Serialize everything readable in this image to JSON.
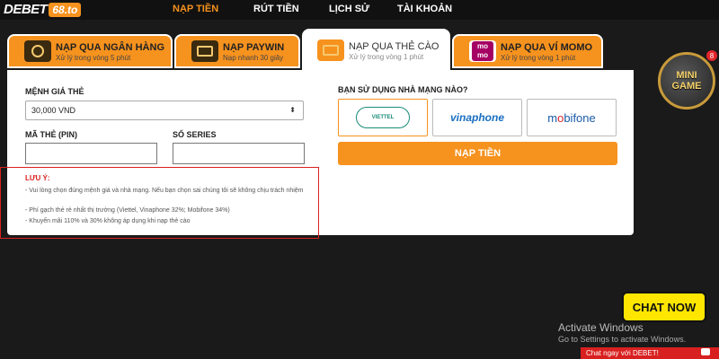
{
  "header": {
    "logo_text": "DEBET",
    "logo_domain": "68.to",
    "nav": [
      {
        "label": "NẠP TIỀN",
        "active": true
      },
      {
        "label": "RÚT TIỀN",
        "active": false
      },
      {
        "label": "LỊCH SỬ",
        "active": false
      },
      {
        "label": "TÀI KHOẢN",
        "active": false
      }
    ]
  },
  "tabs": [
    {
      "title": "NẠP QUA NGÂN HÀNG",
      "sub": "Xử lý trong vòng 5 phút",
      "icon": "bank-card-icon"
    },
    {
      "title": "NẠP PAYWIN",
      "sub": "Nạp nhanh 30 giây",
      "icon": "paywin-icon"
    },
    {
      "title": "NẠP QUA THẺ CÀO",
      "sub": "Xử lý trong vòng 1 phút",
      "icon": "scratch-card-icon",
      "active": true
    },
    {
      "title": "NẠP QUA VÍ MOMO",
      "sub": "Xử lý trong vòng 1 phút",
      "icon": "momo-icon"
    }
  ],
  "form": {
    "denomination_label": "MỆNH GIÁ THẺ",
    "denomination_value": "30,000 VND",
    "pin_label": "MÃ THẺ (PIN)",
    "series_label": "SỐ SERIES",
    "pin_value": "",
    "series_value": ""
  },
  "note": {
    "title": "LƯU Ý:",
    "lines": [
      "- Vui lòng chọn đúng mệnh giá và nhà mạng. Nếu bạn chọn sai chúng tôi sẽ không chịu trách nhiệm",
      "- Phí gạch thẻ rẻ nhất thị trường (Viettel, Vinaphone 32%; Mobifone 34%)",
      "- Khuyến mãi 110% và 30% không áp dụng khi nạp thẻ cào"
    ]
  },
  "carrier": {
    "label": "BẠN SỬ DỤNG NHÀ MẠNG NÀO?",
    "options": [
      {
        "name": "viettel",
        "selected": true
      },
      {
        "name": "vinaphone",
        "selected": false
      },
      {
        "name": "mobifone",
        "selected": false
      }
    ]
  },
  "submit_label": "NẠP TIỀN",
  "minigame": {
    "line1": "MINI",
    "line2": "GAME",
    "badge": "8"
  },
  "chat": {
    "button": "CHAT NOW",
    "bar": "Chat ngay với DEBET!"
  },
  "windows": {
    "line1": "Activate Windows",
    "line2": "Go to Settings to activate Windows."
  },
  "colors": {
    "accent": "#f6921e",
    "alert": "#d92020",
    "background": "#1a1a1a"
  }
}
